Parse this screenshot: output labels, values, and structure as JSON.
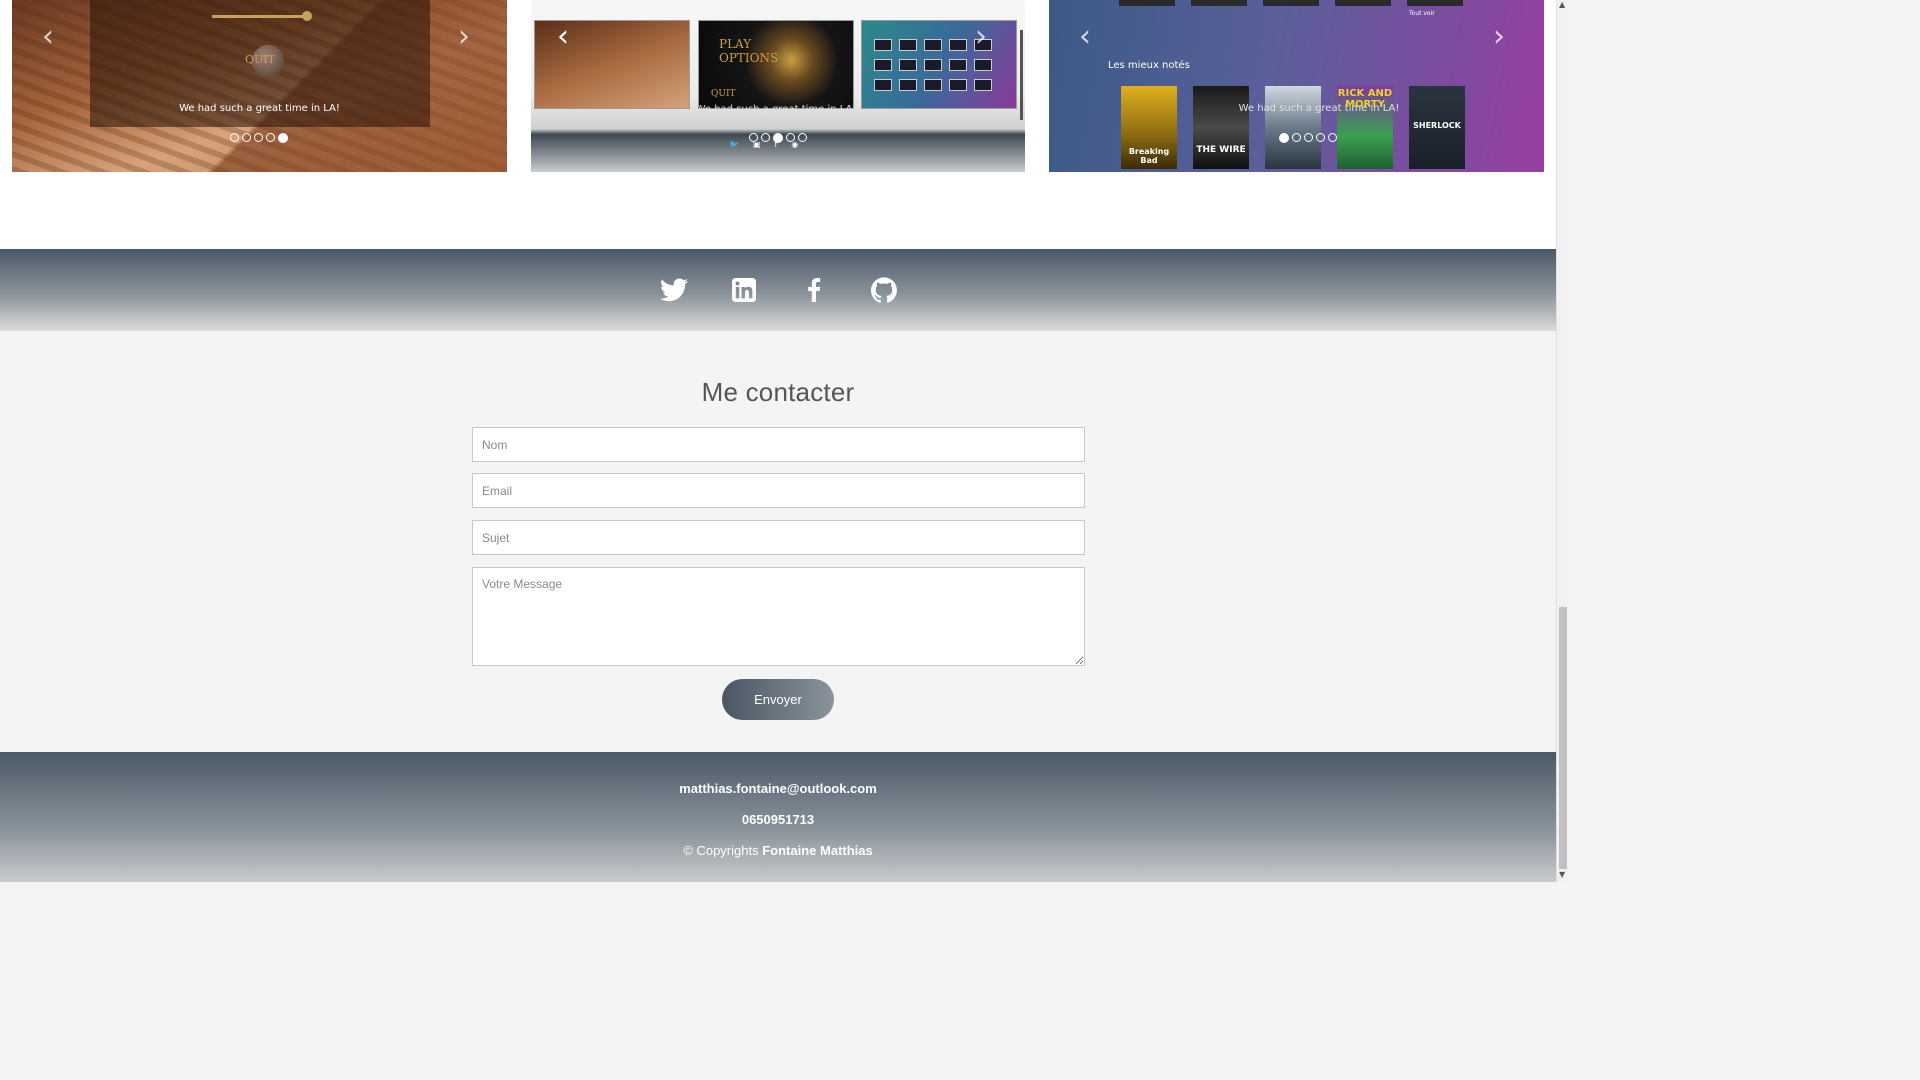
{
  "projects": {
    "card1": {
      "menu_quit": "QUIT",
      "caption": "We had such a great time in LA!",
      "dots": 5,
      "active_dot": 5
    },
    "card2": {
      "thumb_play": "PLAY",
      "thumb_options": "OPTIONS",
      "thumb_quit": "QUIT",
      "caption": "We had such a great time in LA!",
      "dots": 5,
      "active_dot": 3
    },
    "card3": {
      "section_label": "Les mieux notés",
      "tag": "Tout voir",
      "caption": "We had such a great time in LA!",
      "dots": 5,
      "active_dot": 1,
      "posters": [
        "Breaking Bad",
        "THE WIRE",
        "",
        "RICK AND MORTY",
        "SHERLOCK"
      ]
    },
    "arrow_prev": "‹",
    "arrow_next": "›"
  },
  "social": {
    "icons": [
      "twitter-icon",
      "linkedin-icon",
      "facebook-icon",
      "github-icon"
    ]
  },
  "contact": {
    "title": "Me contacter",
    "nom_placeholder": "Nom",
    "email_placeholder": "Email",
    "sujet_placeholder": "Sujet",
    "message_placeholder": "Votre Message",
    "send_label": "Envoyer"
  },
  "footer": {
    "email": "matthias.fontaine@outlook.com",
    "phone": "0650951713",
    "copyright_prefix": "© Copyrights",
    "copyright_name": "Fontaine Matthias"
  },
  "colors": {
    "bar_dark": "#4b5966",
    "bar_light": "#dcdbd8",
    "page_bg": "#f4f4f4",
    "button_start": "#4a5662",
    "button_end": "#8a939c"
  }
}
